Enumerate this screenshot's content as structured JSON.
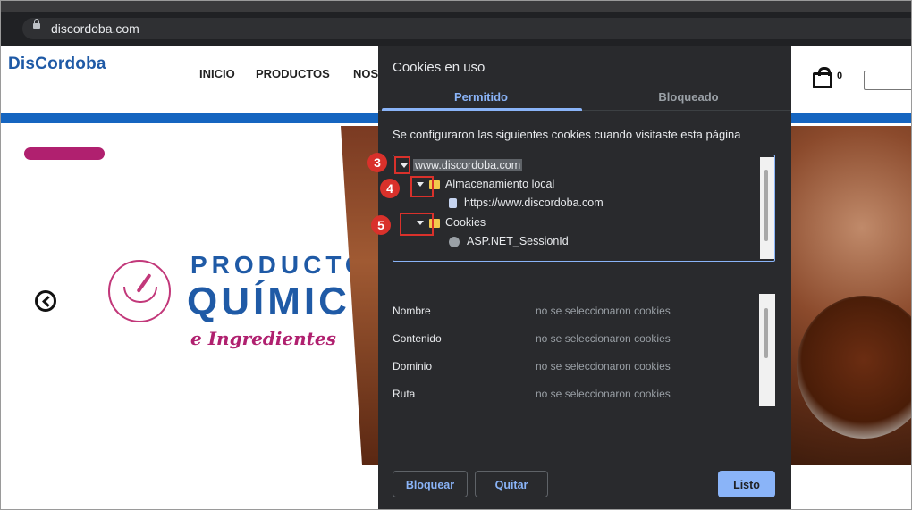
{
  "browser": {
    "url": "discordoba.com"
  },
  "site": {
    "logo": {
      "part1": "Dis",
      "part2": "Cordoba"
    },
    "nav": [
      "INICIO",
      "PRODUCTOS",
      "NOS"
    ],
    "cart_count": "0",
    "banner": {
      "line1": "PRODUCTO",
      "line2": "QUÍMICO",
      "line3": "e Ingredientes"
    },
    "colors": {
      "brand_blue": "#1f5aa6",
      "brand_magenta": "#b0206f"
    }
  },
  "dialog": {
    "title": "Cookies en uso",
    "tabs": [
      {
        "label": "Permitido",
        "active": true
      },
      {
        "label": "Bloqueado",
        "active": false
      }
    ],
    "description": "Se configuraron las siguientes cookies cuando visitaste esta página",
    "tree": {
      "root": "www.discordoba.com",
      "local_storage": "Almacenamiento local",
      "local_storage_item": "https://www.discordoba.com",
      "cookies": "Cookies",
      "cookie_item": "ASP.NET_SessionId"
    },
    "annotations": [
      "3",
      "4",
      "5"
    ],
    "properties": [
      {
        "label": "Nombre",
        "value": "no se seleccionaron cookies"
      },
      {
        "label": "Contenido",
        "value": "no se seleccionaron cookies"
      },
      {
        "label": "Dominio",
        "value": "no se seleccionaron cookies"
      },
      {
        "label": "Ruta",
        "value": "no se seleccionaron cookies"
      }
    ],
    "buttons": {
      "block": "Bloquear",
      "remove": "Quitar",
      "done": "Listo"
    },
    "colors": {
      "accent": "#8ab4f8",
      "background": "#292a2d",
      "annotation_red": "#d9312b"
    }
  }
}
